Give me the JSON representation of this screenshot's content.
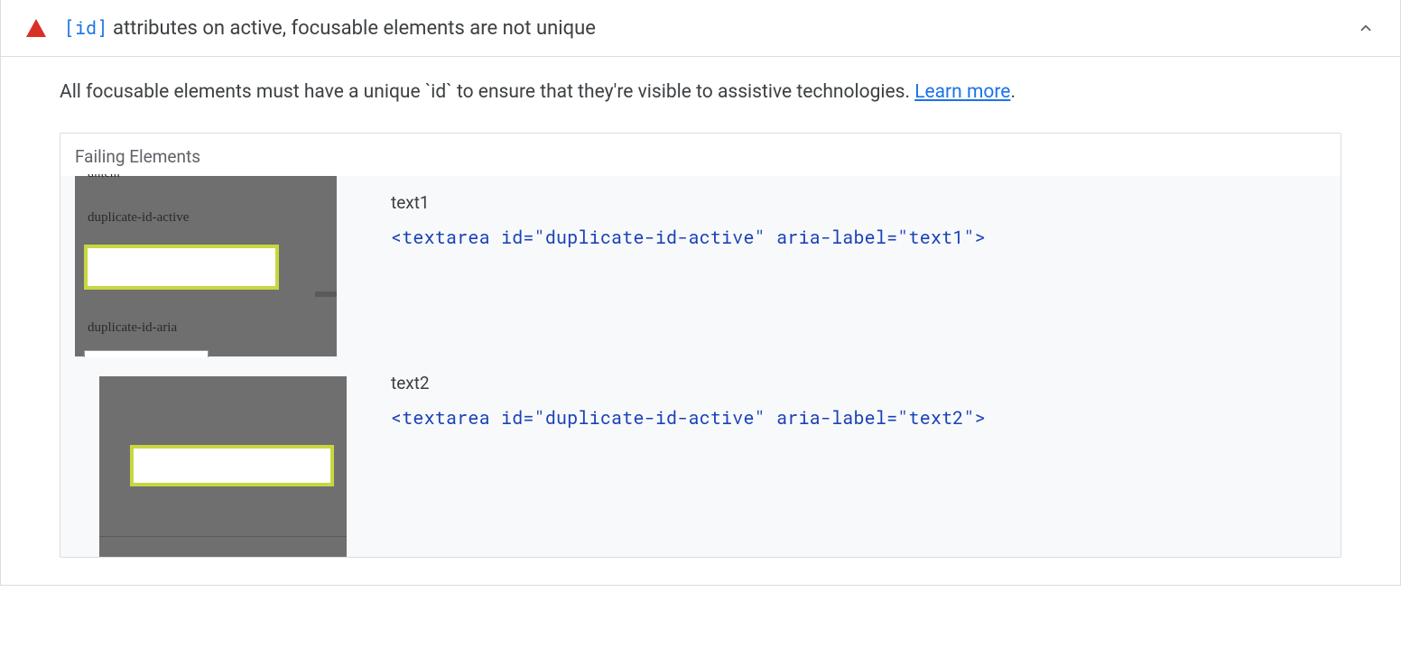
{
  "audit": {
    "code_tag": "[id]",
    "title_suffix": "attributes on active, focusable elements are not unique",
    "description": "All focusable elements must have a unique `id` to ensure that they're visible to assistive technologies. ",
    "learn_more": "Learn more",
    "period": "."
  },
  "failing": {
    "title": "Failing Elements",
    "items": [
      {
        "label": "text1",
        "code": "<textarea id=\"duplicate-id-active\" aria-label=\"text1\">",
        "thumb_labels": {
          "cut": "dlitem",
          "l1": "duplicate-id-active",
          "l2": "duplicate-id-aria"
        }
      },
      {
        "label": "text2",
        "code": "<textarea id=\"duplicate-id-active\" aria-label=\"text2\">"
      }
    ]
  }
}
